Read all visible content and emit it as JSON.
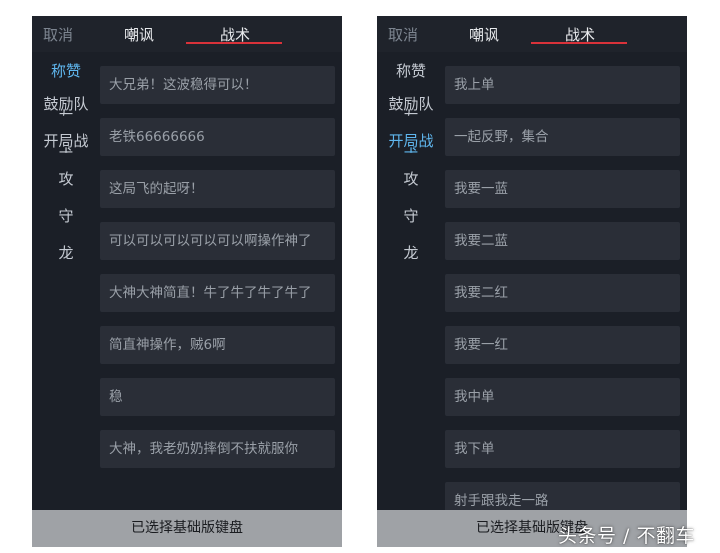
{
  "left_panel": {
    "cancel_label": "取消",
    "tabs": [
      "嘲讽",
      "战术"
    ],
    "sidebar": [
      {
        "label": "称赞"
      },
      {
        "label": "鼓励队",
        "spill": "友"
      },
      {
        "label": "开局战",
        "spill": "术"
      },
      {
        "label": "攻"
      },
      {
        "label": "守"
      },
      {
        "label": "龙"
      }
    ],
    "active_sidebar_index": 0,
    "messages": [
      "大兄弟！这波稳得可以！",
      "老铁66666666",
      "这局飞的起呀！",
      "可以可以可以可以可以啊操作神了",
      "大神大神简直！牛了牛了牛了牛了",
      "简直神操作，贼6啊",
      "稳",
      "大神，我老奶奶摔倒不扶就服你"
    ],
    "bottom_label": "已选择基础版键盘"
  },
  "right_panel": {
    "cancel_label": "取消",
    "tabs": [
      "嘲讽",
      "战术"
    ],
    "sidebar": [
      {
        "label": "称赞"
      },
      {
        "label": "鼓励队",
        "spill": "友"
      },
      {
        "label": "开局战",
        "spill": "术"
      },
      {
        "label": "攻"
      },
      {
        "label": "守"
      },
      {
        "label": "龙"
      }
    ],
    "active_sidebar_index": 2,
    "messages": [
      "我上单",
      "一起反野，集合",
      "我要一蓝",
      "我要二蓝",
      "我要二红",
      "我要一红",
      "我中单",
      "我下单",
      "射手跟我走一路"
    ],
    "bottom_label": "已选择基础版键盘"
  },
  "watermark": "头条号 / 不翻车",
  "colors": {
    "panel_bg": "#1b1f27",
    "item_bg": "#2a2e37",
    "accent_active": "#5fb6ee",
    "tab_underline": "#d9323a",
    "bottom_bar": "#9fa2a6"
  }
}
